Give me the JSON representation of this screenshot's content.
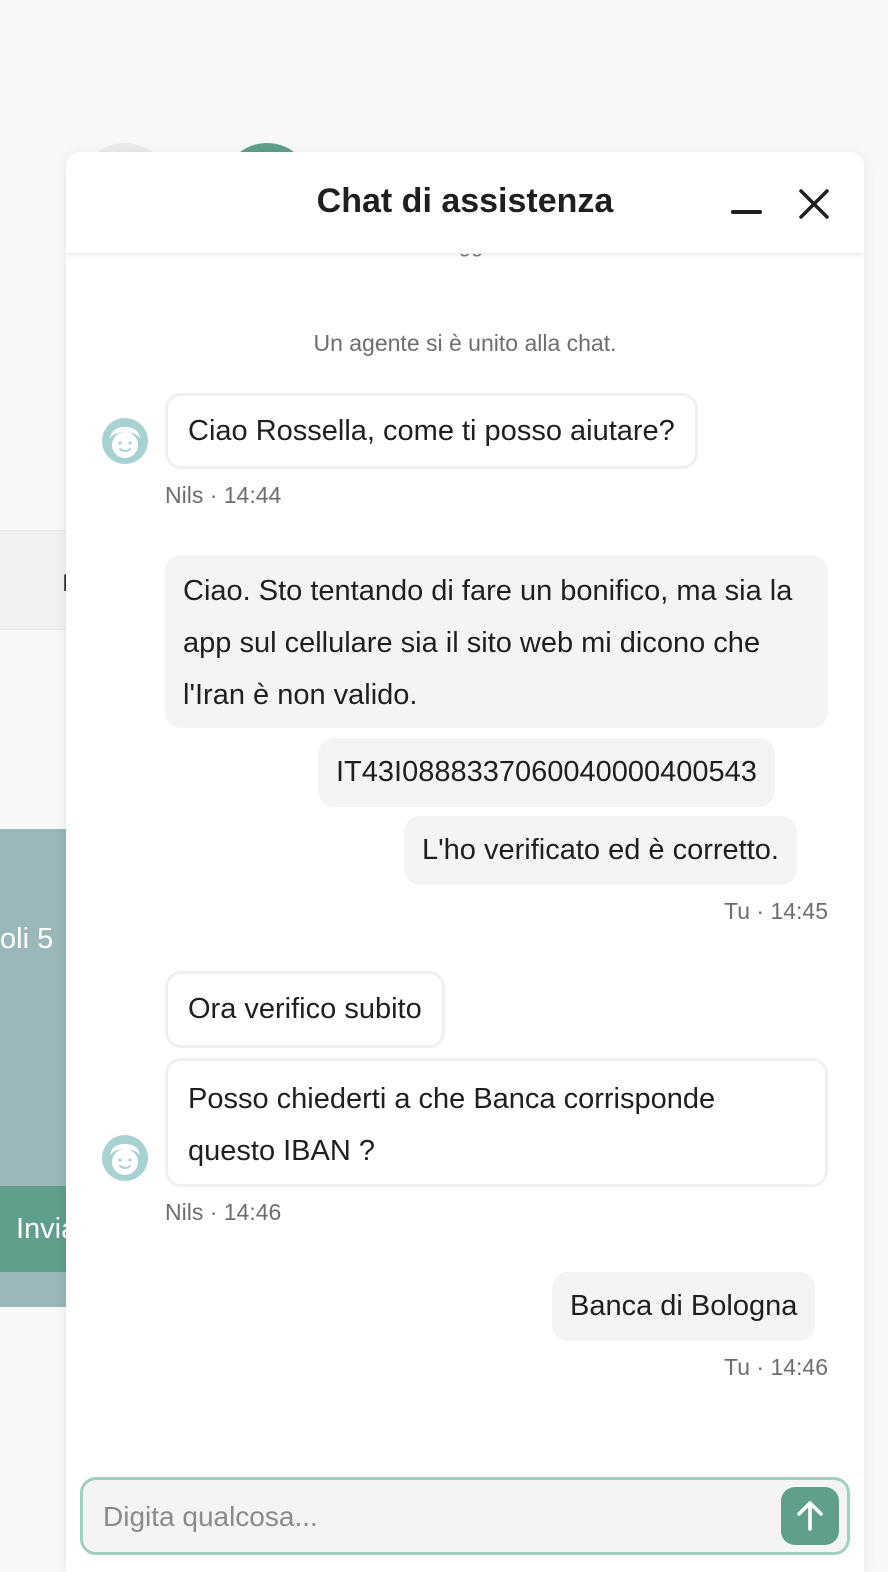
{
  "background": {
    "strip_text": "I",
    "card_text": "oli 5",
    "button_label": "Invia"
  },
  "chat": {
    "title": "Chat di assistenza",
    "date_label": "Oggi",
    "system_message": "Un agente si è unito alla chat.",
    "messages": [
      {
        "from": "agent",
        "lines": [
          "Ciao Rossella, come ti posso aiutare?"
        ],
        "meta": "Nils · 14:44"
      },
      {
        "from": "user",
        "lines": [
          "Ciao. Sto tentando di fare un bonifico, ma sia la app sul cellulare sia il sito web mi dicono che l'Iran è non valido.",
          "IT43I0888337060040000400543",
          "L'ho verificato ed è corretto."
        ],
        "meta": "Tu · 14:45"
      },
      {
        "from": "agent",
        "lines": [
          "Ora verifico subito",
          "Posso chiederti a che Banca corrisponde questo IBAN ?"
        ],
        "meta": "Nils · 14:46"
      },
      {
        "from": "user",
        "lines": [
          "Banca di Bologna"
        ],
        "meta": "Tu · 14:46"
      }
    ]
  },
  "composer": {
    "placeholder": "Digita qualcosa..."
  },
  "icons": {
    "minimize": "minimize-icon",
    "close": "close-icon",
    "avatar": "agent-avatar-icon",
    "send": "arrow-up-icon"
  },
  "colors": {
    "accent": "#5f9f8b",
    "composer_border": "#9fcfc1",
    "avatar": "#a8d2d2",
    "user_bubble": "#f4f4f5"
  }
}
